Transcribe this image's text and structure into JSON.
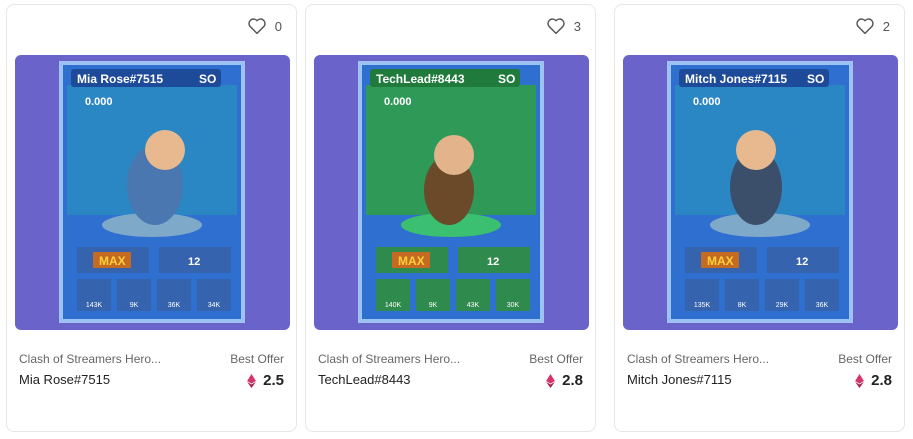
{
  "cards": [
    {
      "likes": "0",
      "card_name": "Mia Rose#7515",
      "rank": "SO",
      "balance": "0.000",
      "max_label": "MAX",
      "level": "12",
      "stats": [
        "143K",
        "9K",
        "36K",
        "34K"
      ],
      "collection": "Clash of Streamers Hero...",
      "title": "Mia Rose#7515",
      "offer_label": "Best Offer",
      "price": "2.5",
      "theme": {
        "frame": "#2f6fd0",
        "header": "#1e4a9a",
        "bg": "#6a63c9",
        "scene": "#2b86c4",
        "hero": "#4b77b0"
      }
    },
    {
      "likes": "3",
      "card_name": "TechLead#8443",
      "rank": "SO",
      "balance": "0.000",
      "max_label": "MAX",
      "level": "12",
      "stats": [
        "140K",
        "9K",
        "43K",
        "30K"
      ],
      "collection": "Clash of Streamers Hero...",
      "title": "TechLead#8443",
      "offer_label": "Best Offer",
      "price": "2.8",
      "theme": {
        "frame": "#2f6fd0",
        "header": "#1f7a3c",
        "bg": "#6a63c9",
        "scene": "#2f9a57",
        "hero": "#6b4a2a"
      }
    },
    {
      "likes": "2",
      "card_name": "Mitch Jones#7115",
      "rank": "SO",
      "balance": "0.000",
      "max_label": "MAX",
      "level": "12",
      "stats": [
        "135K",
        "8K",
        "29K",
        "36K"
      ],
      "collection": "Clash of Streamers Hero...",
      "title": "Mitch Jones#7115",
      "offer_label": "Best Offer",
      "price": "2.8",
      "theme": {
        "frame": "#2f6fd0",
        "header": "#1e4a9a",
        "bg": "#6a63c9",
        "scene": "#2b86c4",
        "hero": "#3b4f6a"
      }
    }
  ],
  "icons": {
    "like": "heart-icon",
    "currency": "ethereum-icon"
  },
  "colors": {
    "eth": "#d6336c",
    "text": "#222222",
    "muted": "#666666"
  }
}
